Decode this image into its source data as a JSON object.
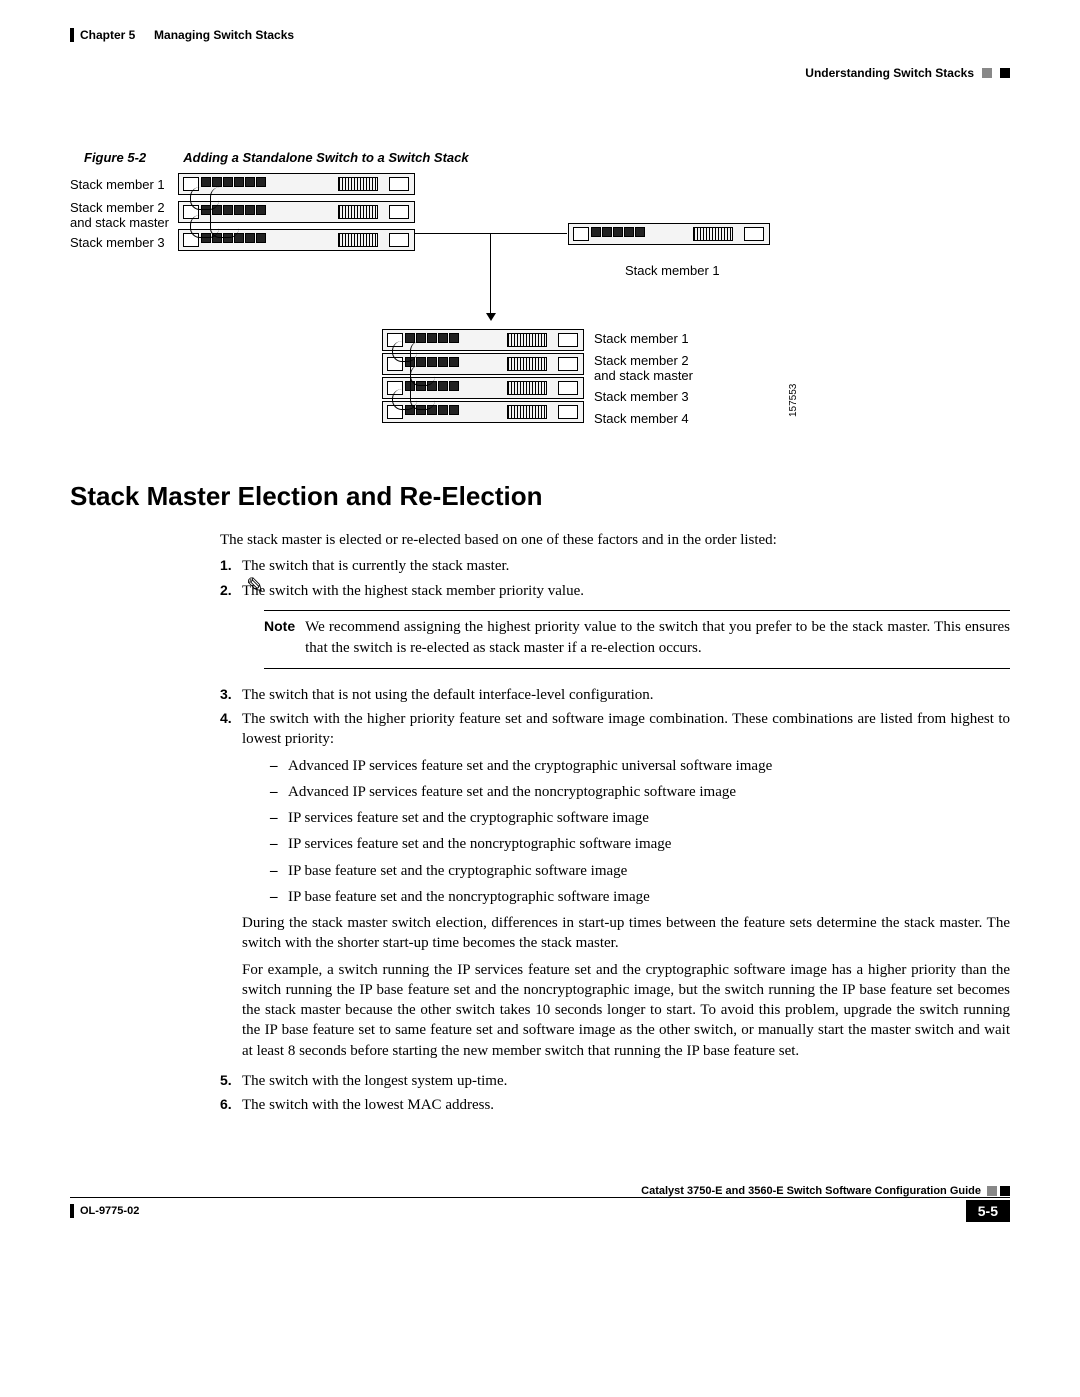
{
  "header": {
    "chapter": "Chapter 5",
    "chapter_title": "Managing Switch Stacks",
    "section": "Understanding Switch Stacks"
  },
  "figure": {
    "number": "Figure 5-2",
    "title": "Adding a Standalone Switch to a Switch Stack",
    "left_labels": {
      "l1": "Stack member 1",
      "l2a": "Stack member 2",
      "l2b": "and stack master",
      "l3": "Stack member 3"
    },
    "right_top_label": "Stack member 1",
    "bottom_labels": {
      "b1": "Stack member 1",
      "b2a": "Stack member 2",
      "b2b": "and stack master",
      "b3": "Stack member 3",
      "b4": "Stack member 4"
    },
    "drawing_id": "157553"
  },
  "heading": "Stack Master Election and Re-Election",
  "intro": "The stack master is elected or re-elected based on one of these factors and in the order listed:",
  "list": {
    "i1": "The switch that is currently the stack master.",
    "i2": "The switch with the highest stack member priority value.",
    "note_label": "Note",
    "note_text": "We recommend assigning the highest priority value to the switch that you prefer to be the stack master. This ensures that the switch is re-elected as stack master if a re-election occurs.",
    "i3": "The switch that is not using the default interface-level configuration.",
    "i4_lead": "The switch with the higher priority feature set and software image combination. These combinations are listed from highest to lowest priority:",
    "dashes": {
      "d1": "Advanced IP services feature set and the cryptographic universal software image",
      "d2": "Advanced IP services feature set and the noncryptographic software image",
      "d3": "IP services feature set and the cryptographic software image",
      "d4": "IP services feature set and the noncryptographic software image",
      "d5": "IP base feature set and the cryptographic software image",
      "d6": "IP base feature set and the noncryptographic software image"
    },
    "i4_p1": "During the stack master switch election, differences in start-up times between the feature sets determine the stack master. The switch with the shorter start-up time becomes the stack master.",
    "i4_p2": "For example, a switch running the IP services feature set and the cryptographic software image has a higher priority than the switch running the IP base feature set and the noncryptographic image, but the switch running the IP base feature set becomes the stack master because the other switch takes 10 seconds longer to start. To avoid this problem, upgrade the switch running the IP base feature set to same feature set and software image as the other switch, or manually start the master switch and wait at least 8 seconds before starting the new member switch that running the IP base feature set.",
    "i5": "The switch with the longest system up-time.",
    "i6": "The switch with the lowest MAC address."
  },
  "footer": {
    "guide_title": "Catalyst 3750-E and 3560-E Switch Software Configuration Guide",
    "doc_id": "OL-9775-02",
    "page": "5-5"
  }
}
